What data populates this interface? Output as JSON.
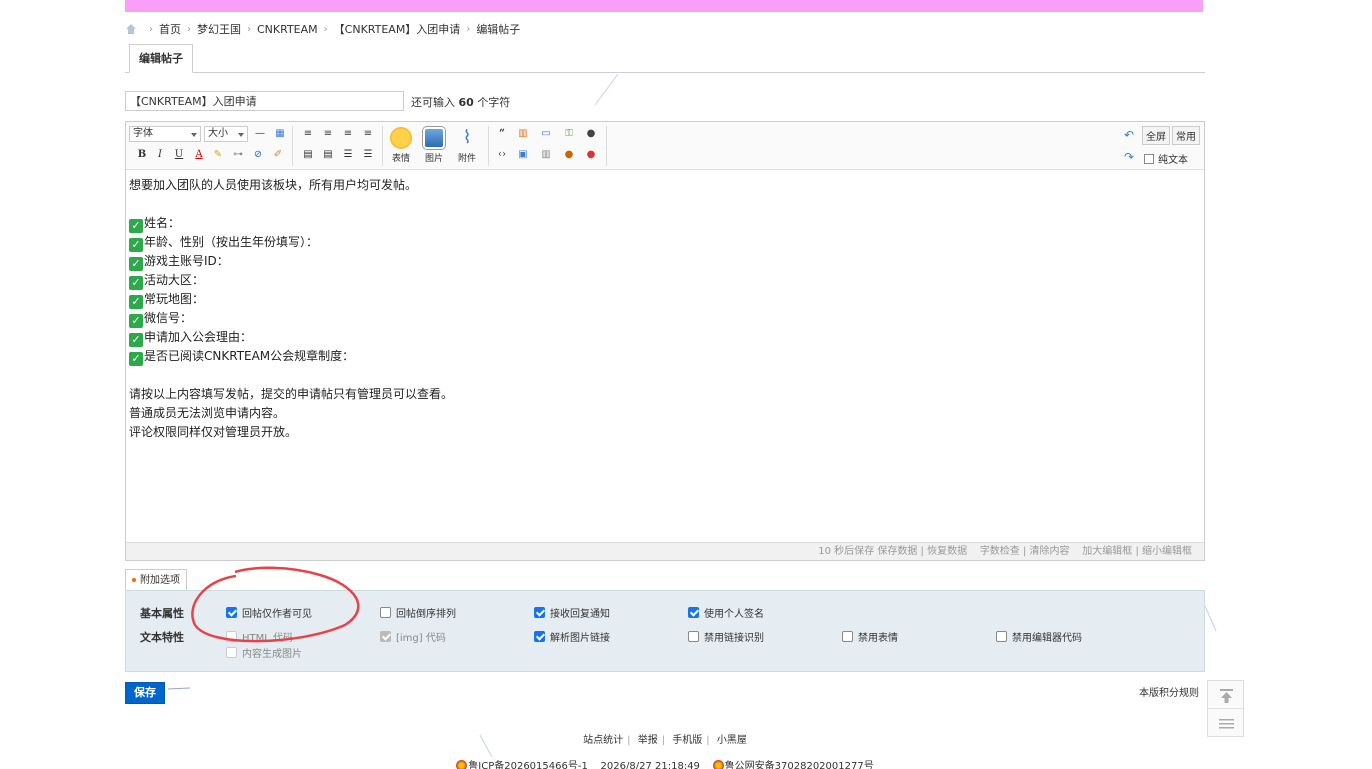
{
  "breadcrumb": {
    "items": [
      "首页",
      "梦幻王国",
      "CNKRTEAM",
      "【CNKRTEAM】入团申请",
      "编辑帖子"
    ]
  },
  "tab": {
    "label": "编辑帖子"
  },
  "subject": {
    "value": "【CNKRTEAM】入团申请",
    "hint_prefix": "还可输入",
    "hint_count": "60",
    "hint_suffix": "个字符"
  },
  "toolbar": {
    "font_label": "字体",
    "size_label": "大小",
    "emoji_label": "表情",
    "image_label": "图片",
    "attach_label": "附件",
    "fullscreen_label": "全屏",
    "common_label": "常用",
    "plaintext_label": "纯文本"
  },
  "content": {
    "intro": "想要加入团队的人员使用该板块，所有用户均可发帖。",
    "fields": [
      "姓名：",
      "年龄、性别（按出生年份填写）：",
      "游戏主账号ID：",
      "活动大区：",
      "常玩地图：",
      "微信号：",
      "申请加入公会理由：",
      "是否已阅读CNKRTEAM公会规章制度："
    ],
    "notes": [
      "请按以上内容填写发帖，提交的申请帖只有管理员可以查看。",
      "普通成员无法浏览申请内容。",
      "评论权限同样仅对管理员开放。"
    ]
  },
  "statusbar": {
    "autosave": "10 秒后保存",
    "save_data": "保存数据",
    "restore_data": "恢复数据",
    "word_check": "字数检查",
    "clear": "清除内容",
    "enlarge": "加大编辑框",
    "shrink": "缩小编辑框"
  },
  "options": {
    "tab_label": "附加选项",
    "basic_label": "基本属性",
    "text_label": "文本特性",
    "basic": [
      {
        "label": "回帖仅作者可见",
        "checked": true
      },
      {
        "label": "回帖倒序排列",
        "checked": false
      },
      {
        "label": "接收回复通知",
        "checked": true
      },
      {
        "label": "使用个人签名",
        "checked": true
      }
    ],
    "text": [
      {
        "label": "HTML 代码",
        "checked": false,
        "disabled": true
      },
      {
        "label": "[img] 代码",
        "checked": true,
        "disabled": true
      },
      {
        "label": "解析图片链接",
        "checked": true
      },
      {
        "label": "禁用链接识别",
        "checked": false
      },
      {
        "label": "禁用表情",
        "checked": false
      },
      {
        "label": "禁用编辑器代码",
        "checked": false
      },
      {
        "label": "内容生成图片",
        "checked": false,
        "disabled": true
      }
    ]
  },
  "save_label": "保存",
  "rules_label": "本版积分规则",
  "footer": {
    "links": [
      "站点统计",
      "举报",
      "手机版",
      "小黑屋"
    ],
    "icp": "鲁ICP备2026015466号-1",
    "datetime": "2026/8/27 21:18:49",
    "police": "鲁公网安备37028202001277号"
  },
  "colors": {
    "top_bar": "#f8a0f8",
    "save_button": "#0066cc",
    "annotation_circle": "#e8414a",
    "check_green": "#2da84a"
  }
}
